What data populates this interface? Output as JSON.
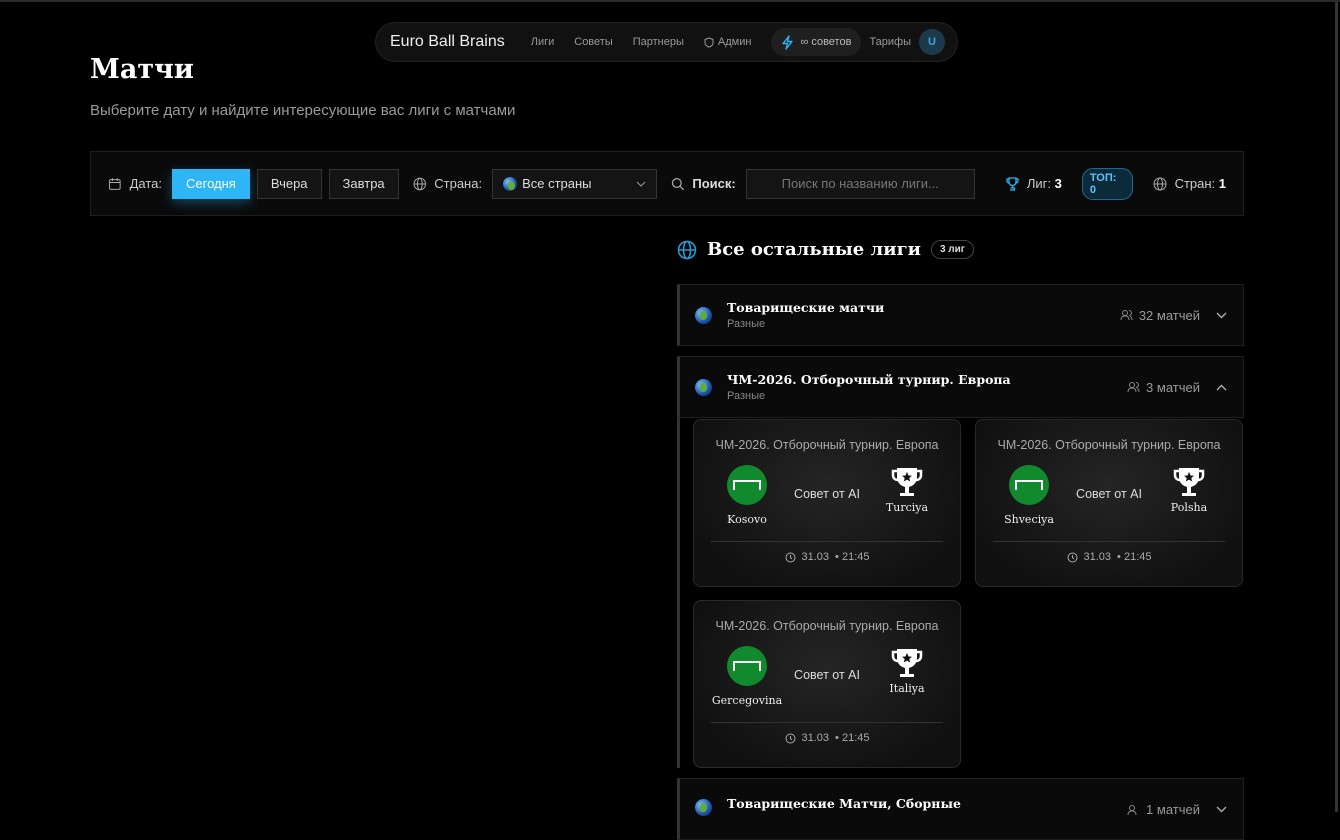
{
  "nav": {
    "brand": "Euro Ball Brains",
    "links": [
      "Лиги",
      "Советы",
      "Партнеры",
      "Админ"
    ],
    "tips": "∞ советов",
    "tariffs": "Тарифы",
    "avatar": "U"
  },
  "page": {
    "title": "Матчи",
    "subtitle": "Выберите дату и найдите интересующие вас лиги с матчами"
  },
  "filters": {
    "date_label": "Дата:",
    "dates": [
      "Сегодня",
      "Вчера",
      "Завтра"
    ],
    "active_date": "Сегодня",
    "country_label": "Страна:",
    "country_value": "Все страны",
    "search_label": "Поиск:",
    "search_placeholder": "Поиск по названию лиги...",
    "search_value": "",
    "leagues_label": "Лиг:",
    "leagues_count": "3",
    "top_badge": "ТОП: 0",
    "countries_label": "Стран:",
    "countries_count": "1"
  },
  "colors": {
    "accent": "#2db5f5",
    "background": "#000000"
  },
  "section": {
    "title": "Все остальные лиги",
    "badge": "3 лиг"
  },
  "leagues": [
    {
      "name": "Товарищеские матчи",
      "region": "Разные",
      "count": "32 матчей",
      "expanded": false
    },
    {
      "name": "ЧМ-2026. Отборочный турнир. Европа",
      "region": "Разные",
      "count": "3 матчей",
      "expanded": true
    },
    {
      "name": "Товарищеские Матчи, Сборные",
      "region": "",
      "count": "1 матчей",
      "expanded": false
    }
  ],
  "matches": [
    {
      "league": "ЧМ-2026. Отборочный турнир. Европа",
      "home": "Kosovo",
      "away": "Turciya",
      "tip": "Совет от AI",
      "date": "31.03",
      "time": "• 21:45"
    },
    {
      "league": "ЧМ-2026. Отборочный турнир. Европа",
      "home": "Shveciya",
      "away": "Polsha",
      "tip": "Совет от AI",
      "date": "31.03",
      "time": "• 21:45"
    },
    {
      "league": "ЧМ-2026. Отборочный турнир. Европа",
      "home": "Gercegovina",
      "away": "Italiya",
      "tip": "Совет от AI",
      "date": "31.03",
      "time": "• 21:45"
    }
  ]
}
